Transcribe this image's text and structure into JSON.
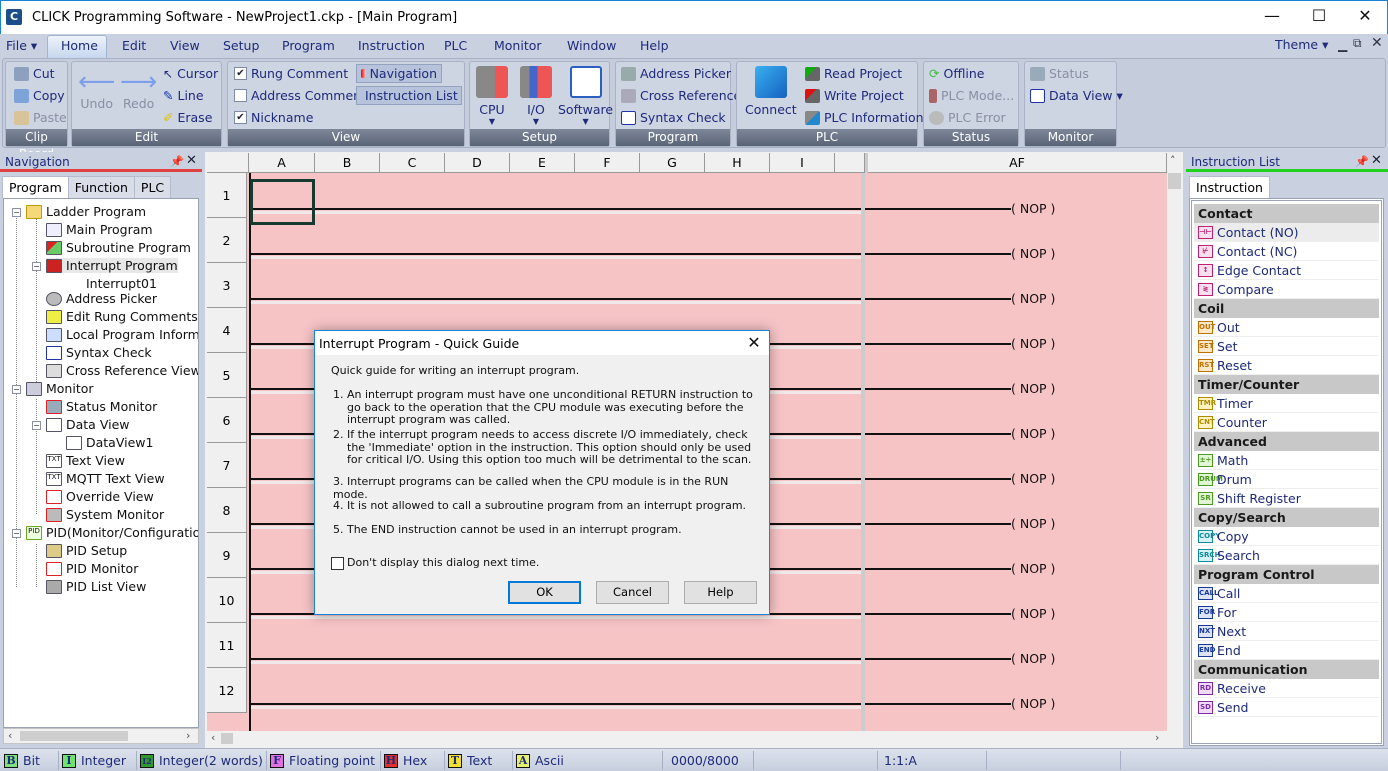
{
  "window": {
    "title": "CLICK Programming Software  - NewProject1.ckp - [Main Program]",
    "minimize": "—",
    "maximize": "☐",
    "close": "✕"
  },
  "menubar": {
    "items": [
      "File ▾",
      "Home",
      "Edit",
      "View",
      "Setup",
      "Program",
      "Instruction",
      "PLC",
      "Monitor",
      "Window",
      "Help"
    ],
    "theme": "Theme ▾"
  },
  "ribbon": {
    "clipboard": {
      "label": "Clip Board",
      "cut": "Cut",
      "copy": "Copy",
      "paste": "Paste"
    },
    "edit": {
      "label": "Edit",
      "undo": "Undo",
      "redo": "Redo",
      "cursor": "Cursor",
      "line": "Line",
      "erase": "Erase"
    },
    "view": {
      "label": "View",
      "rung_comment": "Rung Comment",
      "address_comment": "Address Comment",
      "nickname": "Nickname",
      "navigation": "Navigation",
      "instruction_list": "Instruction List",
      "rung_comment_checked": true,
      "address_comment_checked": false,
      "nickname_checked": true
    },
    "setup": {
      "label": "Setup",
      "cpu": "CPU",
      "io": "I/O",
      "software": "Software"
    },
    "program": {
      "label": "Program",
      "address_picker": "Address Picker",
      "cross_reference": "Cross Reference",
      "syntax_check": "Syntax Check"
    },
    "plc": {
      "label": "PLC",
      "connect": "Connect",
      "read_project": "Read Project",
      "write_project": "Write Project",
      "plc_information": "PLC Information"
    },
    "status": {
      "label": "Status",
      "offline": "Offline",
      "plc_mode": "PLC Mode...",
      "plc_error": "PLC Error"
    },
    "monitor": {
      "label": "Monitor",
      "status": "Status",
      "data_view": "Data View ▾"
    }
  },
  "navigation": {
    "title": "Navigation",
    "tabs": [
      "Program",
      "Function",
      "PLC"
    ],
    "tree": [
      "Ladder Program",
      "Main Program",
      "Subroutine Program",
      "Interrupt Program",
      "Interrupt01",
      "Address Picker",
      "Edit Rung Comments",
      "Local Program Informati",
      "Syntax Check",
      "Cross Reference View",
      "Monitor",
      "Status Monitor",
      "Data View",
      "DataView1",
      "Text View",
      "MQTT Text View",
      "Override View",
      "System Monitor",
      "PID(Monitor/Configuration)",
      "PID Setup",
      "PID Monitor",
      "PID List View"
    ]
  },
  "ladder": {
    "columns": [
      "A",
      "B",
      "C",
      "D",
      "E",
      "F",
      "G",
      "H",
      "I",
      "",
      "AF"
    ],
    "rows": [
      "1",
      "2",
      "3",
      "4",
      "5",
      "6",
      "7",
      "8",
      "9",
      "10",
      "11",
      "12"
    ],
    "coil": "( NOP )"
  },
  "instruction_list": {
    "title": "Instruction List",
    "tab": "Instruction",
    "categories": [
      {
        "name": "Contact",
        "items": [
          {
            "label": "Contact (NO)",
            "icon": "⊣⊢"
          },
          {
            "label": "Contact (NC)",
            "icon": "⊬"
          },
          {
            "label": "Edge Contact",
            "icon": "↕"
          },
          {
            "label": "Compare",
            "icon": "≷"
          }
        ]
      },
      {
        "name": "Coil",
        "items": [
          {
            "label": "Out",
            "icon": "OUT"
          },
          {
            "label": "Set",
            "icon": "SET"
          },
          {
            "label": "Reset",
            "icon": "RST"
          }
        ]
      },
      {
        "name": "Timer/Counter",
        "items": [
          {
            "label": "Timer",
            "icon": "TMR"
          },
          {
            "label": "Counter",
            "icon": "CNT"
          }
        ]
      },
      {
        "name": "Advanced",
        "items": [
          {
            "label": "Math",
            "icon": "±÷"
          },
          {
            "label": "Drum",
            "icon": "DRUM"
          },
          {
            "label": "Shift Register",
            "icon": "SR"
          }
        ]
      },
      {
        "name": "Copy/Search",
        "items": [
          {
            "label": "Copy",
            "icon": "COPY"
          },
          {
            "label": "Search",
            "icon": "SRCH"
          }
        ]
      },
      {
        "name": "Program Control",
        "items": [
          {
            "label": "Call",
            "icon": "CALL"
          },
          {
            "label": "For",
            "icon": "FOR"
          },
          {
            "label": "Next",
            "icon": "NXT"
          },
          {
            "label": "End",
            "icon": "END"
          }
        ]
      },
      {
        "name": "Communication",
        "items": [
          {
            "label": "Receive",
            "icon": "RD"
          },
          {
            "label": "Send",
            "icon": "SD"
          }
        ]
      }
    ]
  },
  "statusbar": {
    "items": [
      {
        "label": "Bit",
        "icon": "B",
        "color": "#7fe07f"
      },
      {
        "label": "Integer",
        "icon": "I",
        "color": "#6fe36f"
      },
      {
        "label": "Integer(2 words)",
        "icon": "I2",
        "color": "#2e9a2e"
      },
      {
        "label": "Floating point",
        "icon": "F",
        "color": "#e070e0"
      },
      {
        "label": "Hex",
        "icon": "H",
        "color": "#e03030"
      },
      {
        "label": "Text",
        "icon": "T",
        "color": "#f0e030"
      },
      {
        "label": "Ascii",
        "icon": "A",
        "color": "#e8f070"
      }
    ],
    "count": "0000/8000",
    "position": "1:1:A"
  },
  "dialog": {
    "title": "Interrupt Program - Quick Guide",
    "intro": "Quick guide for writing an interrupt program.",
    "items": [
      "1.  An interrupt program must have one unconditional RETURN instruction to go back to the operation that the CPU module was executing before the interrupt program was called.",
      "2.  If the interrupt program needs to access discrete I/O immediately, check the 'Immediate' option in the instruction. This option should only be used for critical I/O. Using this option too much will be detrimental to the scan.",
      "3.  Interrupt programs can be called when the CPU module is in the RUN mode.",
      "4.  It is not allowed to call a subroutine program from an interrupt program.",
      "5.  The END instruction cannot be used in an interrupt program."
    ],
    "checkbox": "Don't display this dialog next time.",
    "ok": "OK",
    "cancel": "Cancel",
    "help": "Help",
    "close": "✕"
  }
}
